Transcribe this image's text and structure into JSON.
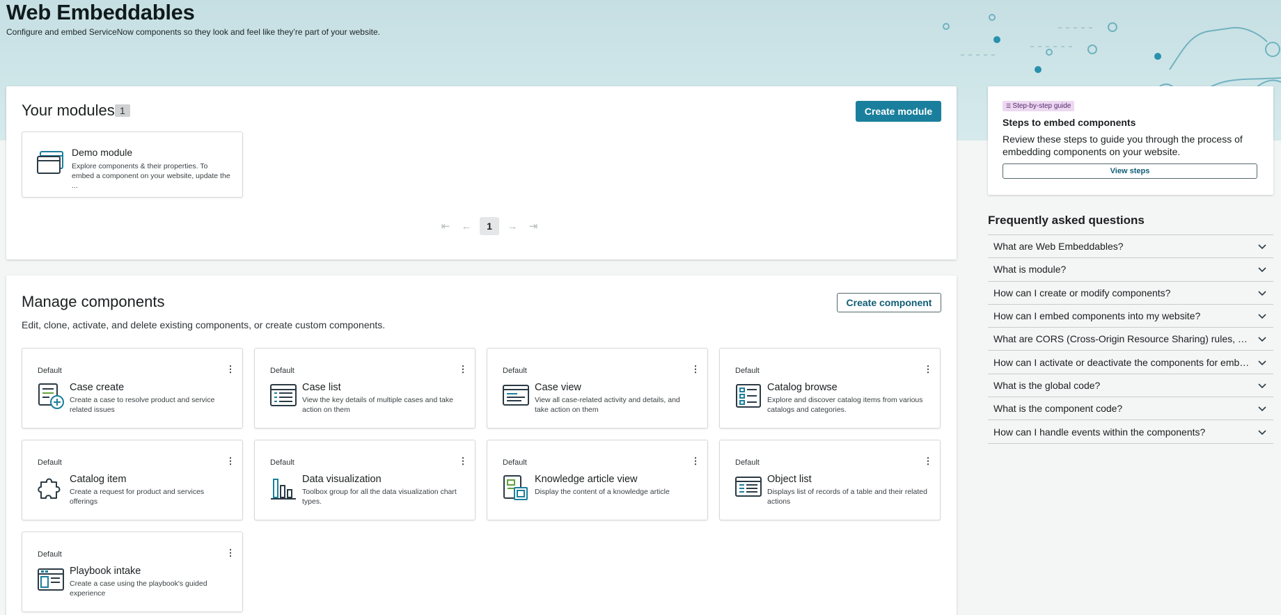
{
  "header": {
    "title": "Web Embeddables",
    "subtitle": "Configure and embed ServiceNow components so they look and feel like they’re part of your website."
  },
  "modules": {
    "title": "Your modules",
    "count": "1",
    "create_label": "Create module",
    "items": [
      {
        "name": "Demo module",
        "description": "Explore components & their properties. To embed a component on your website, update the ..."
      }
    ],
    "pagination": {
      "first": "⇤",
      "prev": "←",
      "current": "1",
      "next": "→",
      "last": "⇥"
    }
  },
  "components": {
    "title": "Manage components",
    "description": "Edit, clone, activate, and delete existing components, or create custom components.",
    "create_label": "Create component",
    "items": [
      {
        "tag": "Default",
        "name": "Case create",
        "description": "Create a case to resolve product and service related issues",
        "icon": "case-create-icon"
      },
      {
        "tag": "Default",
        "name": "Case list",
        "description": "View the key details of multiple cases and take action on them",
        "icon": "case-list-icon"
      },
      {
        "tag": "Default",
        "name": "Case view",
        "description": "View all case-related activity and details, and take action on them",
        "icon": "case-view-icon"
      },
      {
        "tag": "Default",
        "name": "Catalog browse",
        "description": "Explore and discover catalog items from various catalogs and categories.",
        "icon": "catalog-browse-icon"
      },
      {
        "tag": "Default",
        "name": "Catalog item",
        "description": "Create a request for product and services offerings",
        "icon": "puzzle-icon"
      },
      {
        "tag": "Default",
        "name": "Data visualization",
        "description": "Toolbox group for all the data visualization chart types.",
        "icon": "bar-chart-icon"
      },
      {
        "tag": "Default",
        "name": "Knowledge article view",
        "description": "Display the content of a knowledge article",
        "icon": "knowledge-article-icon"
      },
      {
        "tag": "Default",
        "name": "Object list",
        "description": "Displays list of records of a table and their related actions",
        "icon": "object-list-icon"
      },
      {
        "tag": "Default",
        "name": "Playbook intake",
        "description": "Create a case using the playbook's guided experience",
        "icon": "playbook-icon"
      }
    ]
  },
  "guide": {
    "tag": "Step-by-step guide",
    "title": "Steps to embed components",
    "description": "Review these steps to guide you through the process of embedding components on your website.",
    "button_label": "View steps"
  },
  "faq": {
    "title": "Frequently asked questions",
    "items": [
      "What are Web Embeddables?",
      "What is module?",
      "How can I create or modify components?",
      "How can I embed components into my website?",
      "What are CORS (Cross-Origin Resource Sharing) rules, and why are they important?",
      "How can I activate or deactivate the components for embedding?",
      "What is the global code?",
      "What is the component code?",
      "How can I handle events within the components?"
    ]
  },
  "colors": {
    "primary": "#1a7f9c",
    "icon_dark": "#2b3a44",
    "icon_accent": "#1a7f9c",
    "icon_green": "#62a13a"
  }
}
